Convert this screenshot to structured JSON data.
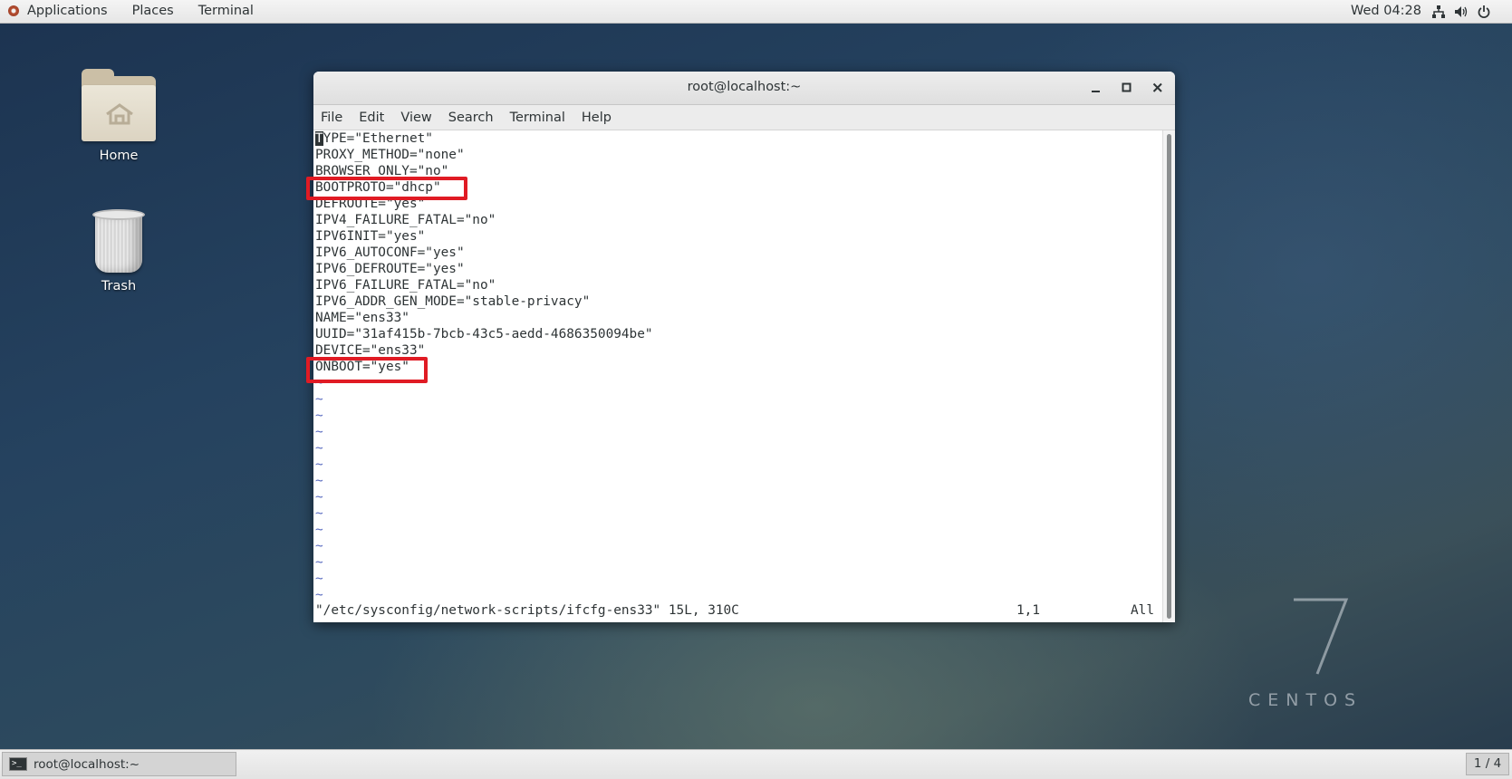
{
  "topbar": {
    "applications": "Applications",
    "places": "Places",
    "terminal": "Terminal",
    "clock": "Wed 04:28",
    "icons": [
      "network-icon",
      "volume-icon",
      "power-icon"
    ]
  },
  "desktop": {
    "home_label": "Home",
    "trash_label": "Trash"
  },
  "window": {
    "title": "root@localhost:~",
    "menu": [
      "File",
      "Edit",
      "View",
      "Search",
      "Terminal",
      "Help"
    ],
    "file_lines": [
      "TYPE=\"Ethernet\"",
      "PROXY_METHOD=\"none\"",
      "BROWSER_ONLY=\"no\"",
      "BOOTPROTO=\"dhcp\"",
      "DEFROUTE=\"yes\"",
      "IPV4_FAILURE_FATAL=\"no\"",
      "IPV6INIT=\"yes\"",
      "IPV6_AUTOCONF=\"yes\"",
      "IPV6_DEFROUTE=\"yes\"",
      "IPV6_FAILURE_FATAL=\"no\"",
      "IPV6_ADDR_GEN_MODE=\"stable-privacy\"",
      "NAME=\"ens33\"",
      "UUID=\"31af415b-7bcb-43c5-aedd-4686350094be\"",
      "DEVICE=\"ens33\"",
      "ONBOOT=\"yes\""
    ],
    "empty_line_marker": "~",
    "status_file": "\"/etc/sysconfig/network-scripts/ifcfg-ens33\" 15L, 310C",
    "status_position": "1,1",
    "status_scroll": "All",
    "highlight_color": "#e01b24"
  },
  "watermark": {
    "number": "7",
    "word": "CENTOS"
  },
  "taskbar": {
    "task_label": "root@localhost:~",
    "workspace": "1 / 4"
  }
}
